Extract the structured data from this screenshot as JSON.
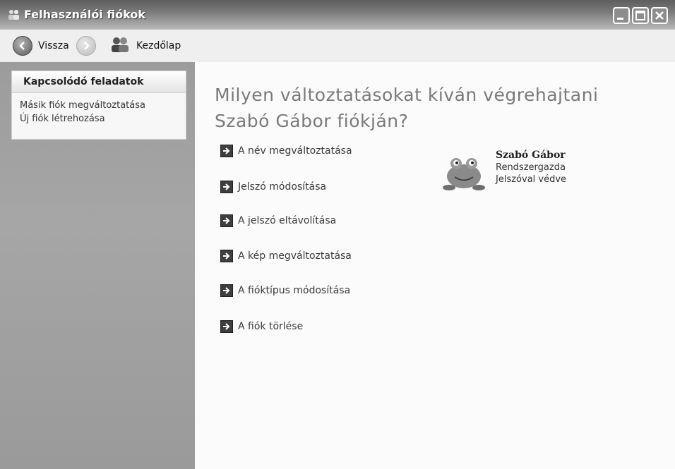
{
  "window": {
    "title": "Felhasználói fiókok",
    "icon": "user-accounts-icon",
    "buttons": [
      "minimize-icon",
      "maximize-icon",
      "close-icon"
    ]
  },
  "toolbar": {
    "back_label": "Vissza",
    "forward_icon": "forward-arrow-icon",
    "home_label": "Kezdőlap"
  },
  "sidebar": {
    "panel_title": "Kapcsolódó feladatok",
    "links": [
      {
        "label": "Másik fiók megváltoztatása"
      },
      {
        "label": "Új fiók létrehozása"
      }
    ]
  },
  "main": {
    "headline": "Milyen változtatásokat kíván végrehajtani Szabó Gábor fiókján?",
    "tasks": [
      {
        "label": "A név megváltoztatása"
      },
      {
        "label": "Jelszó módosítása"
      },
      {
        "label": "A jelszó eltávolítása"
      },
      {
        "label": "A kép megváltoztatása"
      },
      {
        "label": "A fióktípus módosítása"
      },
      {
        "label": "A fiók törlése"
      }
    ],
    "account": {
      "name": "Szabó Gábor",
      "role": "Rendszergazda",
      "status": "Jelszóval védve",
      "avatar": "frog-avatar"
    }
  },
  "colors": {
    "titlebar": "#7a7a7a",
    "sidebar": "#9f9f9f",
    "headline": "#7a7a7a"
  }
}
